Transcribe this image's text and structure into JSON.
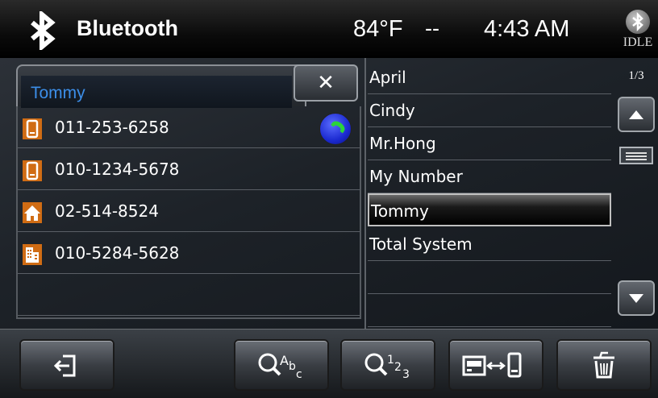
{
  "header": {
    "title": "Bluetooth",
    "temperature": "84°F",
    "separator": "--",
    "time": "4:43 AM",
    "bt_status": "IDLE"
  },
  "search": {
    "value": "Tommy"
  },
  "numbers": [
    {
      "icon": "mobile-phone-icon",
      "number": "011-253-6258"
    },
    {
      "icon": "mobile-phone-icon",
      "number": "010-1234-5678"
    },
    {
      "icon": "home-icon",
      "number": "02-514-8524"
    },
    {
      "icon": "office-building-icon",
      "number": "010-5284-5628"
    }
  ],
  "contacts": [
    "April",
    "Cindy",
    "Mr.Hong",
    "My Number",
    "Tommy",
    "Total System"
  ],
  "selected_contact": "Tommy",
  "page_indicator": "1/3",
  "toolbar": {
    "buttons": [
      "exit-icon",
      "search-alphabet-icon",
      "search-number-icon",
      "phone-transfer-icon",
      "delete-icon"
    ]
  },
  "colors": {
    "accent_blue": "#3c8ee8",
    "call_green": "#2bd43a",
    "icon_orange": "#d06c14"
  }
}
